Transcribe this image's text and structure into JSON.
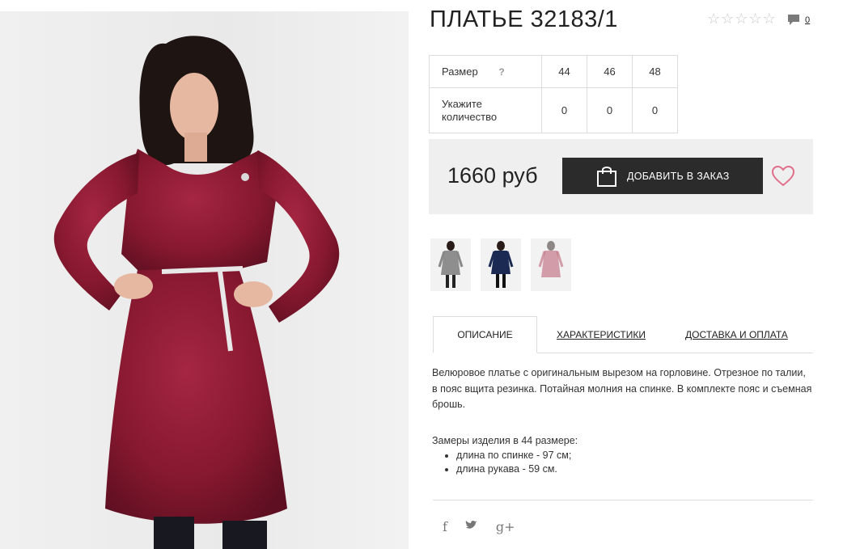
{
  "product": {
    "title": "ПЛАТЬЕ 32183/1",
    "rating_stars": 0,
    "comments_count": "0"
  },
  "sizes": {
    "row1_label": "Размер",
    "help": "?",
    "values": [
      "44",
      "46",
      "48"
    ],
    "row2_label": "Укажите количество",
    "quantities": [
      "0",
      "0",
      "0"
    ]
  },
  "buy": {
    "price": "1660 руб",
    "add_button": "ДОБАВИТЬ В ЗАКАЗ"
  },
  "tabs": [
    "ОПИСАНИЕ",
    "ХАРАКТЕРИСТИКИ",
    "ДОСТАВКА И ОПЛАТА"
  ],
  "description": {
    "text": "Велюровое платье с оригинальным вырезом на горловине. Отрезное по талии, в пояс вщита резинка. Потайная молния на спинке. В комплекте пояс и съемная брошь.",
    "measures_title": "Замеры изделия в 44 размере:",
    "measures": [
      "длина по спинке - 97 см;",
      "длина рукава - 59 см."
    ]
  },
  "social": [
    "f",
    "t",
    "g+"
  ],
  "colors": {
    "dress": "#8c1a33",
    "button": "#2b2b2b",
    "heart": "#e0708a"
  }
}
